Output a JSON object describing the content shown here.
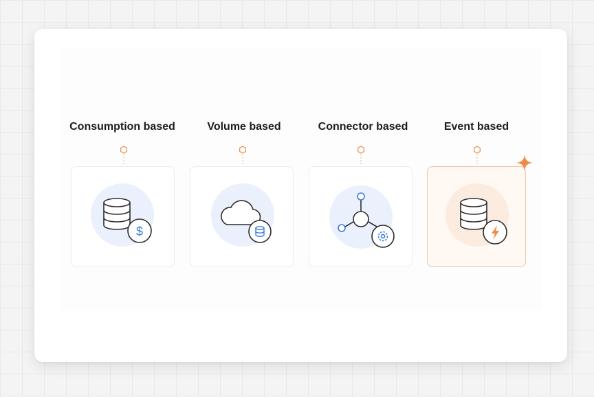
{
  "columns": [
    {
      "title": "Consumption based",
      "icon": "database-dollar-icon",
      "badge": "$"
    },
    {
      "title": "Volume based",
      "icon": "cloud-database-icon"
    },
    {
      "title": "Connector based",
      "icon": "network-gear-icon"
    },
    {
      "title": "Event based",
      "icon": "database-lightning-icon",
      "selected": true
    }
  ],
  "colors": {
    "blue_accent": "#3a7de0",
    "orange_accent": "#ee8a45",
    "blue_circle": "#eaf1fd",
    "orange_circle": "#fcebdf",
    "line": "#2c2c2c"
  }
}
